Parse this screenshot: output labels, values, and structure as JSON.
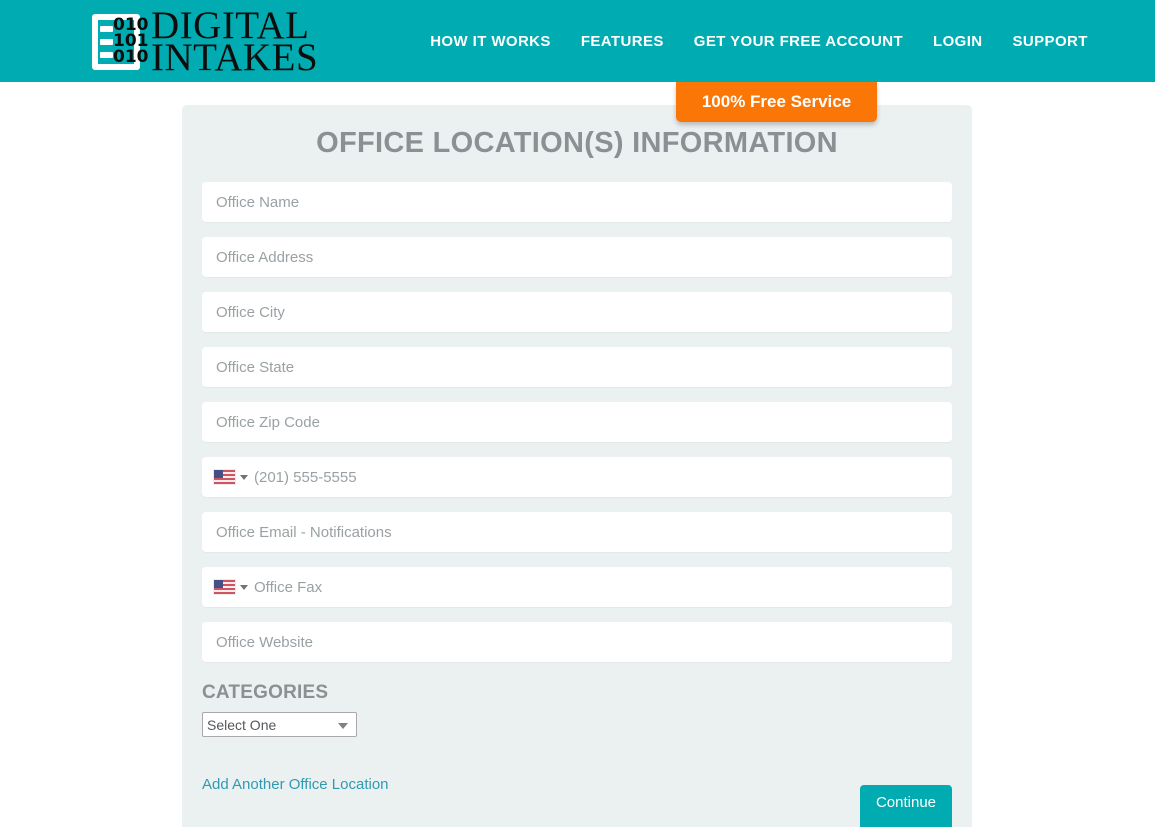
{
  "header": {
    "brand": {
      "icon": "clipboard-binary-logo",
      "bits_line1": "010",
      "bits_line2": "101",
      "bits_line3": "010",
      "word_line1": "DIGITAL",
      "word_line2": "INTAKES"
    },
    "nav": [
      {
        "label": "HOW IT WORKS",
        "name": "nav-how-it-works"
      },
      {
        "label": "FEATURES",
        "name": "nav-features"
      },
      {
        "label": "GET YOUR FREE ACCOUNT",
        "name": "nav-get-free-account"
      },
      {
        "label": "LOGIN",
        "name": "nav-login"
      },
      {
        "label": "SUPPORT",
        "name": "nav-support"
      }
    ],
    "badge": "100% Free Service",
    "colors": {
      "header_teal": "#00acb1",
      "badge_orange": "#f97607"
    }
  },
  "form": {
    "title": "OFFICE LOCATION(S) INFORMATION",
    "fields": [
      {
        "placeholder": "Office Name",
        "value": "",
        "flag": false,
        "name": "office-name-input"
      },
      {
        "placeholder": "Office Address",
        "value": "",
        "flag": false,
        "name": "office-address-input"
      },
      {
        "placeholder": "Office City",
        "value": "",
        "flag": false,
        "name": "office-city-input"
      },
      {
        "placeholder": "Office State",
        "value": "",
        "flag": false,
        "name": "office-state-input"
      },
      {
        "placeholder": "Office Zip Code",
        "value": "",
        "flag": false,
        "name": "office-zip-code-input"
      },
      {
        "placeholder": "(201) 555-5555",
        "value": "",
        "flag": true,
        "name": "office-phone-input"
      },
      {
        "placeholder": "Office Email - Notifications",
        "value": "",
        "flag": false,
        "name": "office-email-input"
      },
      {
        "placeholder": "Office Fax",
        "value": "",
        "flag": true,
        "name": "office-fax-input"
      },
      {
        "placeholder": "Office Website",
        "value": "",
        "flag": false,
        "name": "office-website-input"
      }
    ],
    "categories_heading": "CATEGORIES",
    "category_selected": "Select One",
    "category_options": [
      "Select One"
    ],
    "add_location_link": "Add Another Office Location",
    "continue_button": "Continue",
    "colors": {
      "panel_bg": "#ebf0f0",
      "title_gray": "#8a9194",
      "link_teal": "#2f9bb3",
      "button_teal": "#00acb1"
    }
  }
}
